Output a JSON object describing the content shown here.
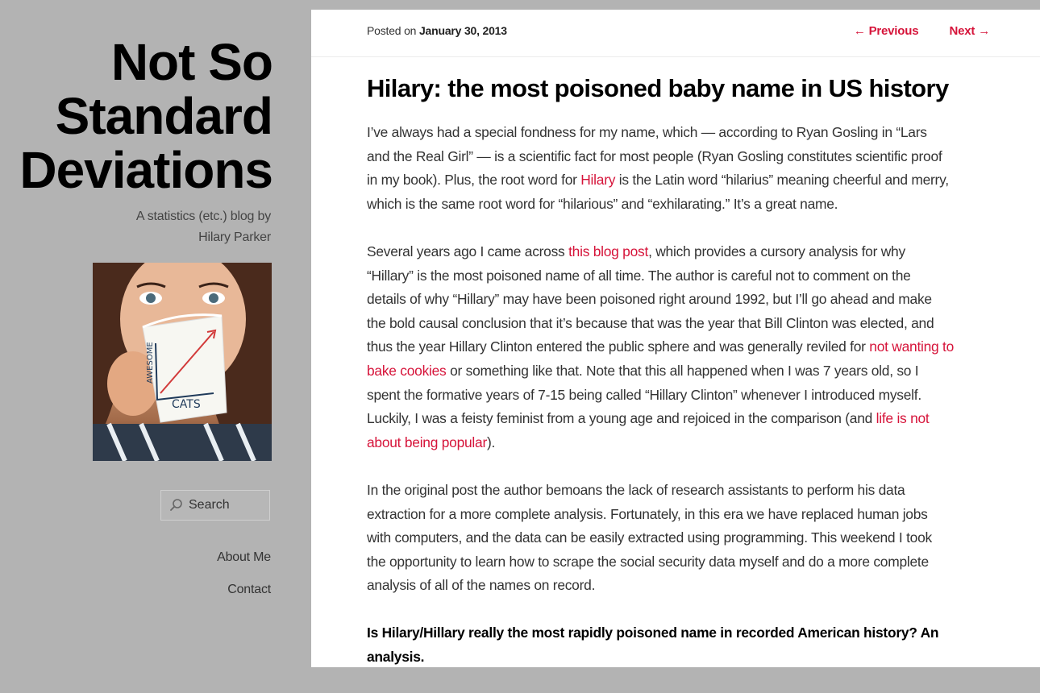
{
  "sidebar": {
    "site_title": [
      "Not So",
      "Standard",
      "Deviations"
    ],
    "tagline": [
      "A statistics (etc.) blog by",
      "Hilary Parker"
    ],
    "avatar_alt": "Hilary Parker",
    "search": {
      "placeholder": "Search"
    },
    "nav": [
      {
        "label": "About Me"
      },
      {
        "label": "Contact"
      }
    ]
  },
  "post": {
    "posted_on_prefix": "Posted on",
    "date": "January 30, 2013",
    "nav": {
      "previous": "← Previous",
      "next": "Next →"
    },
    "title": "Hilary: the most poisoned baby name in US history",
    "paragraphs": [
      {
        "lines": [
          [
            {
              "t": "I’ve always had a special fondness for my name, which — according to Ryan Gosling in “Lars"
            }
          ],
          [
            {
              "t": "and the Real Girl” — is a scientific fact for most people (Ryan Gosling constitutes scientific proof"
            }
          ],
          [
            {
              "t": "in my book). Plus, the root word for "
            },
            {
              "t": "Hilary",
              "link": true
            },
            {
              "t": " is the Latin word “hilarius” meaning cheerful and merry,"
            }
          ],
          [
            {
              "t": "which is the same root word for “hilarious” and “exhilarating.” It’s a great name."
            }
          ]
        ]
      },
      {
        "lines": [
          [
            {
              "t": "Several years ago I came across "
            },
            {
              "t": "this blog post",
              "link": true
            },
            {
              "t": ", which provides a cursory analysis for why"
            }
          ],
          [
            {
              "t": "“Hillary” is the most poisoned name of all time. The author is careful not to comment on the"
            }
          ],
          [
            {
              "t": "details of why “Hillary” may have been poisoned right around 1992, but I’ll go ahead and make"
            }
          ],
          [
            {
              "t": "the bold causal conclusion that it’s because that was the year that Bill Clinton was elected, and"
            }
          ],
          [
            {
              "t": "thus the year Hillary Clinton entered the public sphere and was generally reviled for "
            },
            {
              "t": "not wanting to",
              "link": true
            }
          ],
          [
            {
              "t": "bake cookies",
              "link": true
            },
            {
              "t": " or something like that. Note that this all happened when I was 7 years old, so I"
            }
          ],
          [
            {
              "t": "spent the formative years of 7-15 being called “Hillary Clinton” whenever I introduced myself."
            }
          ],
          [
            {
              "t": "Luckily, I was a feisty feminist from a young age and rejoiced in the comparison (and "
            },
            {
              "t": "life is not",
              "link": true
            }
          ],
          [
            {
              "t": "about being popular",
              "link": true
            },
            {
              "t": ")."
            }
          ]
        ]
      },
      {
        "lines": [
          [
            {
              "t": "In the original post the author bemoans the lack of research assistants to perform his data"
            }
          ],
          [
            {
              "t": "extraction for a more complete analysis. Fortunately, in this era we have replaced human jobs"
            }
          ],
          [
            {
              "t": "with computers, and the data can be easily extracted using programming. This weekend I took"
            }
          ],
          [
            {
              "t": "the opportunity to learn how to scrape the social security data myself and do a more complete"
            }
          ],
          [
            {
              "t": "analysis of all of the names on record."
            }
          ]
        ]
      },
      {
        "bold": true,
        "lines": [
          [
            {
              "t": "Is Hilary/Hillary really the most rapidly poisoned name in recorded American history? An"
            }
          ],
          [
            {
              "t": "analysis."
            }
          ]
        ]
      }
    ]
  },
  "colors": {
    "link": "#d6143a",
    "sidebar_bg": "#b3b3b3",
    "content_bg": "#ffffff"
  }
}
